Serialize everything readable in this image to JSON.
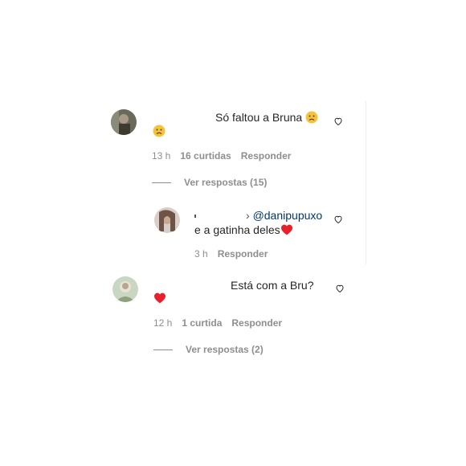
{
  "comments": [
    {
      "text": "Só faltou a Bruna",
      "emoji": "sad-face-emoji",
      "time": "13 h",
      "likes": "16 curtidas",
      "reply_label": "Responder",
      "view_replies": "Ver respostas (15)"
    },
    {
      "text": "Está com a Bru?",
      "emoji": "red-heart-emoji",
      "time": "12 h",
      "likes": "1 curtida",
      "reply_label": "Responder",
      "view_replies": "Ver respostas (2)"
    }
  ],
  "reply": {
    "mention": "@danipupuxo",
    "text": "e a gatinha deles",
    "emoji": "red-heart-emoji",
    "time": "3 h",
    "reply_label": "Responder"
  },
  "colors": {
    "meta_gray": "#8e8e8e",
    "text": "#262626",
    "mention_blue": "#00376b",
    "heart_red": "#ed4956"
  }
}
